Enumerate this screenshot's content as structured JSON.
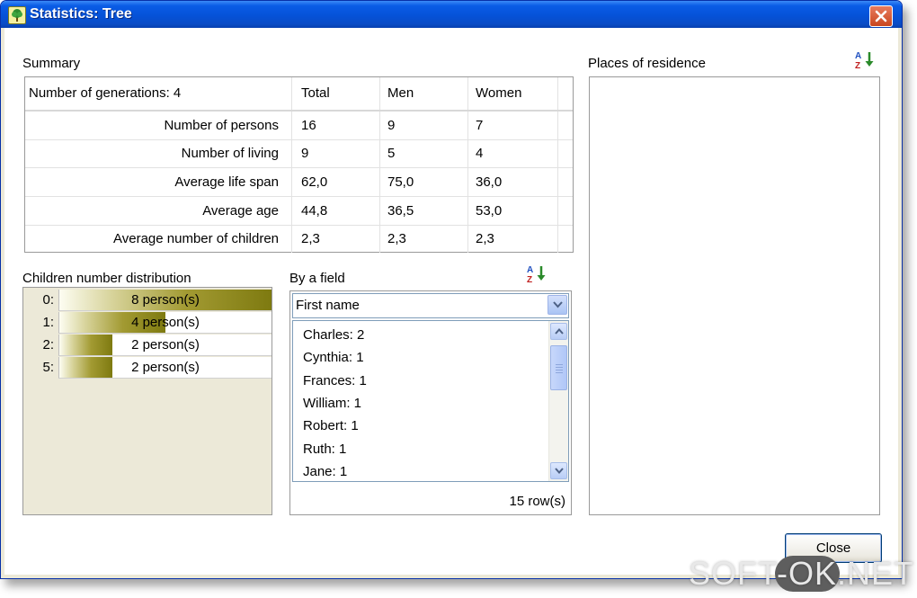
{
  "window": {
    "title": "Statistics: Tree"
  },
  "summary": {
    "label": "Summary",
    "header": {
      "generations": "Number of generations: 4",
      "total": "Total",
      "men": "Men",
      "women": "Women"
    },
    "rows": [
      {
        "label": "Number of persons",
        "total": "16",
        "men": "9",
        "women": "7"
      },
      {
        "label": "Number of living",
        "total": "9",
        "men": "5",
        "women": "4"
      },
      {
        "label": "Average life span",
        "total": "62,0",
        "men": "75,0",
        "women": "36,0"
      },
      {
        "label": "Average age",
        "total": "44,8",
        "men": "36,5",
        "women": "53,0"
      },
      {
        "label": "Average number of children",
        "total": "2,3",
        "men": "2,3",
        "women": "2,3"
      }
    ]
  },
  "distribution": {
    "label": "Children number distribution",
    "rows": [
      {
        "key": "0:",
        "text": "8 person(s)",
        "count": 8
      },
      {
        "key": "1:",
        "text": "4 person(s)",
        "count": 4
      },
      {
        "key": "2:",
        "text": "2 person(s)",
        "count": 2
      },
      {
        "key": "5:",
        "text": "2 person(s)",
        "count": 2
      }
    ]
  },
  "by_field": {
    "label": "By a field",
    "selected": "First name",
    "items": [
      "Charles: 2",
      "Cynthia: 1",
      "Frances: 1",
      "William: 1",
      "Robert: 1",
      "Ruth: 1",
      "Jane: 1"
    ],
    "row_count": "15 row(s)"
  },
  "places": {
    "label": "Places of residence"
  },
  "buttons": {
    "close": "Close"
  },
  "watermark": {
    "text": "SOFT-OK.NET"
  },
  "colors": {
    "titlebar": "#0552d8",
    "bar_dark": "#7e7a10",
    "bar_light": "#fdfdf2"
  }
}
